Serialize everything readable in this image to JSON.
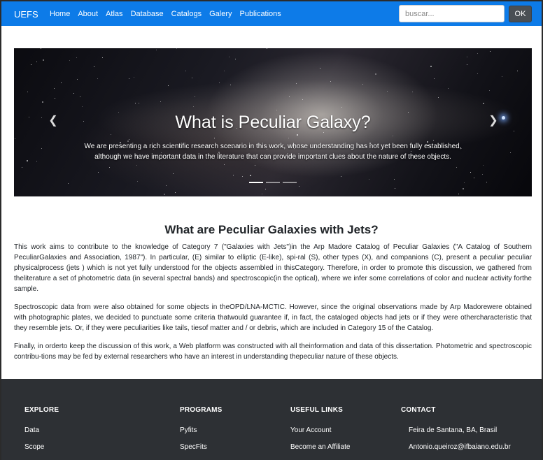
{
  "navbar": {
    "brand": "UEFS",
    "links": [
      "Home",
      "About",
      "Atlas",
      "Database",
      "Catalogs",
      "Galery",
      "Publications"
    ],
    "search_placeholder": "buscar...",
    "search_button": "OK"
  },
  "carousel": {
    "title": "What is Peculiar Galaxy?",
    "text": "We are presenting a rich scientific research scenario in this work, whose understanding has not yet been fully established, although we have important data in the literature that can provide important clues about the nature of these objects.",
    "prev_icon": "chevron-left-icon",
    "next_icon": "chevron-right-icon",
    "indicator_count": 3,
    "active_indicator": 1
  },
  "main": {
    "title": "What are Peculiar Galaxies with Jets?",
    "paragraphs": [
      "This work aims to contribute to the knowledge of Category 7 (\"Galaxies with Jets\")in the Arp Madore Catalog of Peculiar Galaxies (\"A Catalog of Southern PeculiarGalaxies and Association, 1987\"). In particular, (E) similar to elliptic (E-like), spi-ral (S), other types (X), and companions (C), present a peculiar peculiar physicalprocess (jets ) which is not yet fully understood for the objects assembled in thisCategory. Therefore, in order to promote this discussion, we gathered from theliterature a set of photometric data (in several spectral bands) and spectroscopic(in the optical), where we infer some correlations of color and nuclear activity forthe sample.",
      "Spectroscopic data from were also obtained for some objects in theOPD/LNA-MCTIC. However, since the original observations made by Arp Madorewere obtained with photographic plates, we decided to punctuate some criteria thatwould guarantee if, in fact, the cataloged objects had jets or if they were othercharacteristic that they resemble jets. Or, if they were peculiarities like tails, tiesof matter and / or debris, which are included in Category 15 of the Catalog.",
      "Finally, in orderto keep the discussion of this work, a Web platform was constructed with all theinformation and data of this dissertation. Photometric and spectroscopic contribu-tions may be fed by external researchers who have an interest in understanding thepeculiar nature of these objects."
    ]
  },
  "footer": {
    "explore": {
      "heading": "EXPLORE",
      "items": [
        "Data",
        "Scope"
      ]
    },
    "programs": {
      "heading": "PROGRAMS",
      "items": [
        "Pyfits",
        "SpecFits"
      ]
    },
    "useful_links": {
      "heading": "USEFUL LINKS",
      "items": [
        "Your Account",
        "Become an Affiliate"
      ]
    },
    "contact": {
      "heading": "CONTACT",
      "items": [
        "Feira de Santana, BA, Brasil",
        "Antonio.queiroz@ifbaiano.edu.br"
      ]
    }
  },
  "colors": {
    "navbar": "#0d7be8",
    "footer": "#2d3034",
    "button": "#4a4f54"
  }
}
